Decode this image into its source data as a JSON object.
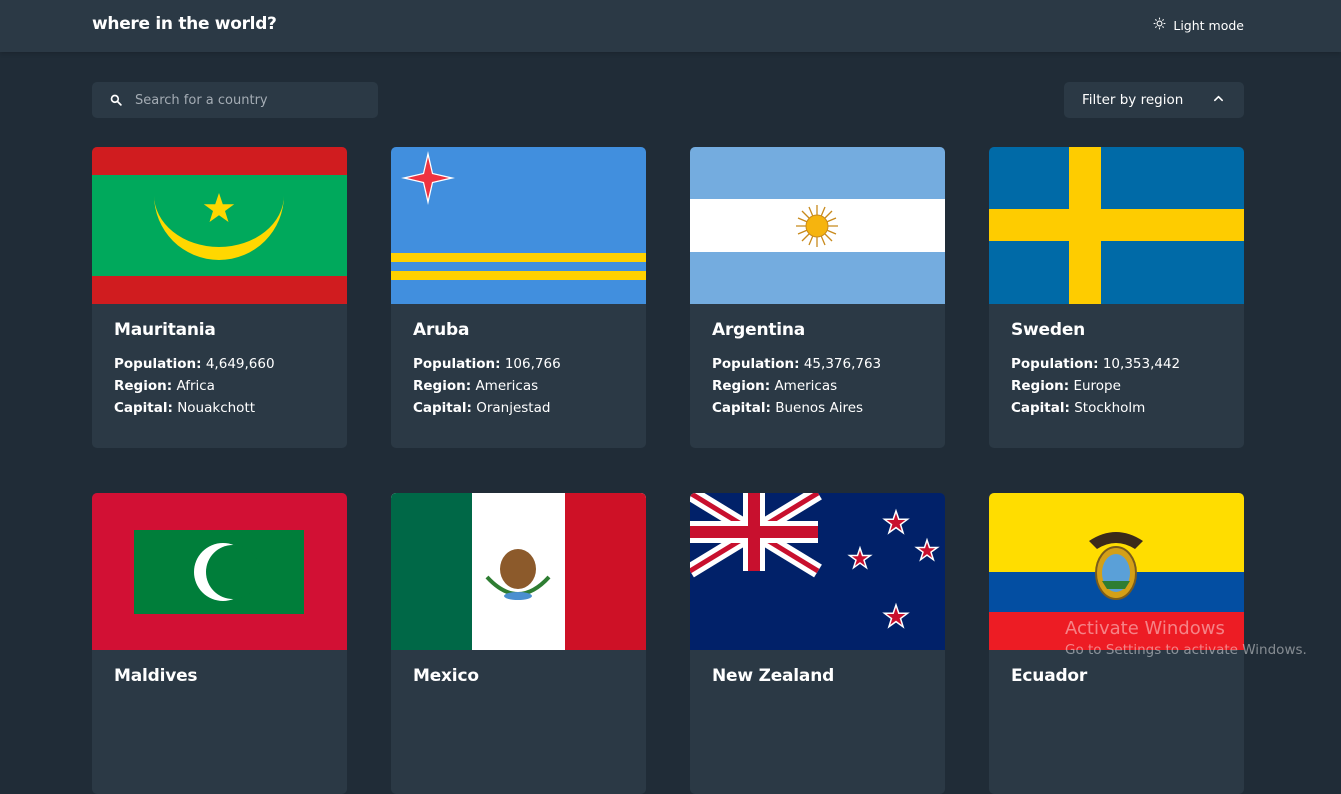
{
  "header": {
    "title": "where in the world?",
    "theme_toggle_label": "Light mode"
  },
  "search": {
    "placeholder": "Search for a country",
    "value": ""
  },
  "filter": {
    "label": "Filter by region"
  },
  "stat_labels": {
    "population": "Population:",
    "region": "Region:",
    "capital": "Capital:"
  },
  "countries": [
    {
      "name": "Mauritania",
      "population": "4,649,660",
      "region": "Africa",
      "capital": "Nouakchott"
    },
    {
      "name": "Aruba",
      "population": "106,766",
      "region": "Americas",
      "capital": "Oranjestad"
    },
    {
      "name": "Argentina",
      "population": "45,376,763",
      "region": "Americas",
      "capital": "Buenos Aires"
    },
    {
      "name": "Sweden",
      "population": "10,353,442",
      "region": "Europe",
      "capital": "Stockholm"
    },
    {
      "name": "Maldives"
    },
    {
      "name": "Mexico"
    },
    {
      "name": "New Zealand"
    },
    {
      "name": "Ecuador"
    }
  ],
  "watermark": {
    "title": "Activate Windows",
    "subtitle": "Go to Settings to activate Windows."
  },
  "colors": {
    "background": "#202c37",
    "surface": "#2b3945",
    "text": "#ffffff",
    "placeholder": "#a4acb4"
  }
}
